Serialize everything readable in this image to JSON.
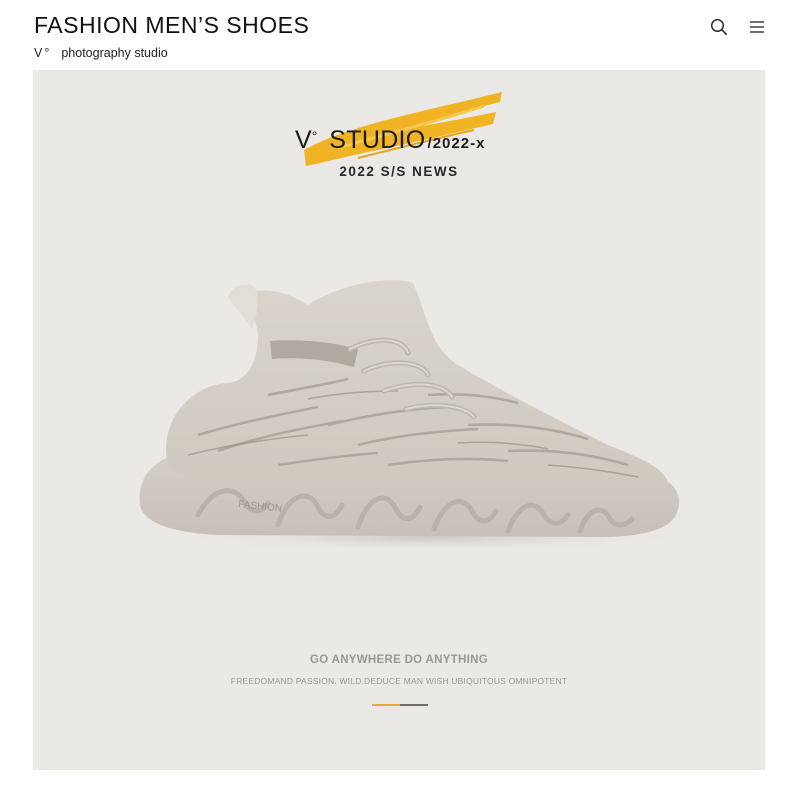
{
  "header": {
    "title": "FASHION MEN’S SHOES",
    "subtitle_mark": "V°",
    "subtitle": "photography studio",
    "icons": [
      "search-icon",
      "menu-icon"
    ]
  },
  "hero": {
    "studio_mark": "V",
    "studio_degree": "°",
    "studio_name": "STUDIO",
    "studio_year": "/2022-x",
    "news": "2022 S/S NEWS",
    "shoe_brand": "FASHION",
    "slogan": "GO ANYWHERE DO ANYTHING",
    "tagline": "FREEDOMAND PASSION. WILD.DEDUCE MAN WISH UBIQUITOUS OMNIPOTENT"
  },
  "colors": {
    "background": "#ebe9e5",
    "accent": "#f0b323",
    "indicator_active": "#e7a937",
    "indicator_inactive": "#6e6e6e",
    "text_muted": "#9a9894"
  }
}
